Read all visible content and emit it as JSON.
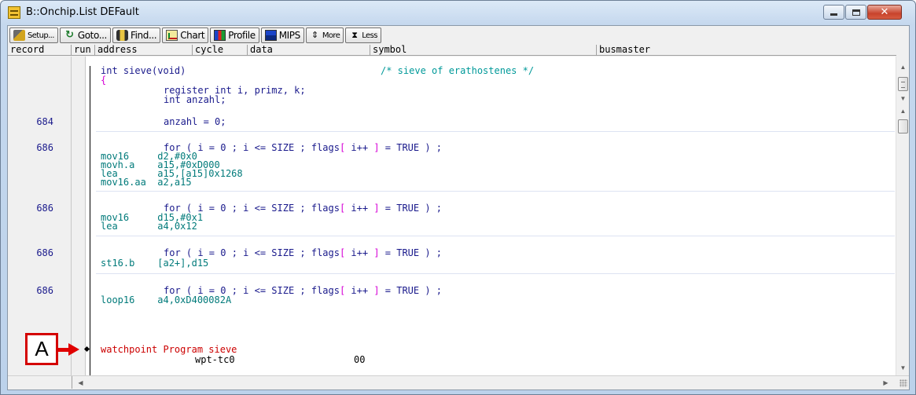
{
  "window": {
    "title": "B::Onchip.List DEFault"
  },
  "toolbar": [
    {
      "label": "Setup...",
      "icon": "setup-icon"
    },
    {
      "label": "Goto...",
      "icon": "goto-icon"
    },
    {
      "label": "Find...",
      "icon": "find-icon"
    },
    {
      "label": "Chart",
      "icon": "chart-icon"
    },
    {
      "label": "Profile",
      "icon": "profile-icon"
    },
    {
      "label": "MIPS",
      "icon": "mips-icon"
    },
    {
      "label": "More",
      "icon": "more-icon"
    },
    {
      "label": "Less",
      "icon": "less-icon"
    }
  ],
  "columns": [
    "record",
    "run",
    "address",
    "cycle",
    "data",
    "symbol",
    "busmaster"
  ],
  "source": {
    "decl": "int sieve(void)",
    "decl_comment": "/* sieve of erathostenes */",
    "open_brace": "{",
    "vars1": "register int i, primz, k;",
    "vars2": "int anzahl;",
    "assign": "anzahl = 0;",
    "for_prefix": "for ( i = 0 ; i <= SIZE ; flags",
    "for_open": "[",
    "for_mid": " i++ ",
    "for_close": "]",
    "for_suffix": " = TRUE ) ;"
  },
  "records": [
    {
      "num": "684"
    },
    {
      "num": "686"
    },
    {
      "num": "686"
    },
    {
      "num": "686"
    },
    {
      "num": "686"
    }
  ],
  "asm": {
    "block1": [
      "mov16     d2,#0x0",
      "movh.a    a15,#0xD000",
      "lea       a15,[a15]0x1268",
      "mov16.aa  a2,a15"
    ],
    "block2": [
      "mov16     d15,#0x1",
      "lea       a4,0x12"
    ],
    "block3": [
      "st16.b    [a2+],d15"
    ],
    "block4": [
      "loop16    a4,0xD400082A"
    ]
  },
  "watchpoint": {
    "text": "watchpoint Program sieve",
    "cycle": "wpt-tc0",
    "data": "00"
  },
  "annotation": {
    "label": "A"
  },
  "colors": {
    "accent_red": "#d40000",
    "source_text": "#1a1a8c",
    "asm_text": "#007a7a",
    "comment": "#009999",
    "highlight_symbol": "#d600d6"
  }
}
